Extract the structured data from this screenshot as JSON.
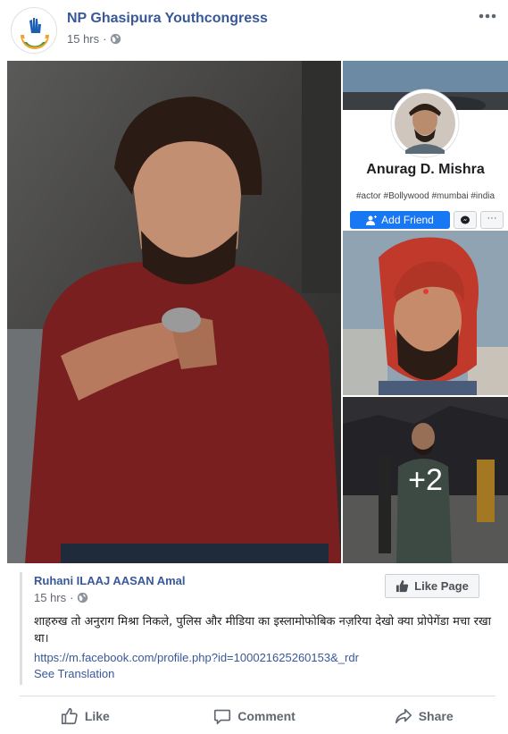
{
  "post": {
    "page_name": "NP Ghasipura Youthcongress",
    "timestamp": "15 hrs",
    "privacy_icon": "globe-icon",
    "more_icon": "more-options-icon"
  },
  "photos": {
    "profile_name": "Anurag D. Mishra",
    "profile_tags": "#actor #Bollywood #mumbai #india",
    "add_friend_label": "Add Friend",
    "more_count_label": "+2"
  },
  "shared": {
    "name": "Ruhani ILAAJ AASAN Amal",
    "timestamp": "15 hrs",
    "like_page_label": "Like Page",
    "text": "शाहरुख तो अनुराग मिश्रा निकले, पुलिस और मीडिया का इस्लामोफोबिक नज़रिया देखो क्या प्रोपेगेंडा मचा रखा था।",
    "link": "https://m.facebook.com/profile.php?id=100021625260153&_rdr",
    "see_translation": "See Translation"
  },
  "actions": {
    "like_label": "Like",
    "comment_label": "Comment",
    "share_label": "Share"
  },
  "colors": {
    "link_blue": "#385898",
    "button_blue": "#1877f2",
    "action_gray": "#606770"
  }
}
